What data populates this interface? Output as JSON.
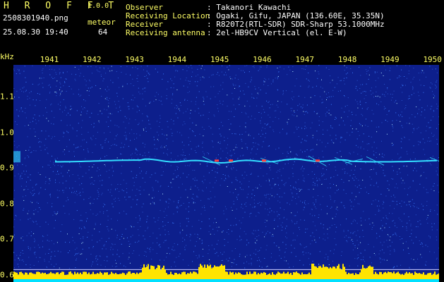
{
  "header": {
    "app_name": "H R O F F T",
    "version": "1.0.0",
    "filename": "2508301940.png",
    "datetime": "25.08.30 19:40",
    "count_label": "meteor",
    "count_value": "64",
    "fields": [
      {
        "key": "Observer",
        "value": ": Takanori Kawachi"
      },
      {
        "key": "Receiving Location",
        "value": ": Ogaki, Gifu, JAPAN (136.60E, 35.35N)"
      },
      {
        "key": "Receiver",
        "value": ": R820T2(RTL-SDR) SDR-Sharp 53.1000MHz"
      },
      {
        "key": "Receiving antenna",
        "value": ": 2el-HB9CV Vertical (el. E-W)"
      }
    ]
  },
  "spectrogram": {
    "y_unit": "kHz",
    "x_ticks": [
      "1941",
      "1942",
      "1943",
      "1944",
      "1945",
      "1946",
      "1947",
      "1948",
      "1949",
      "1950"
    ],
    "y_ticks": [
      "1.1",
      "1.0",
      "0.9",
      "0.8",
      "0.7",
      "0.6"
    ],
    "x_range_minutes": [
      1940,
      1950
    ],
    "y_range_khz": [
      0.58,
      1.19
    ],
    "carrier_khz": 0.92,
    "colors": {
      "background": "#0d1f8c",
      "noise": "#3a7bff",
      "carrier": "#33ddff",
      "echo_hot": "#ff4040",
      "activity": "#ffe400",
      "baseline": "#00e0ff",
      "labels": "#ffff66"
    }
  }
}
